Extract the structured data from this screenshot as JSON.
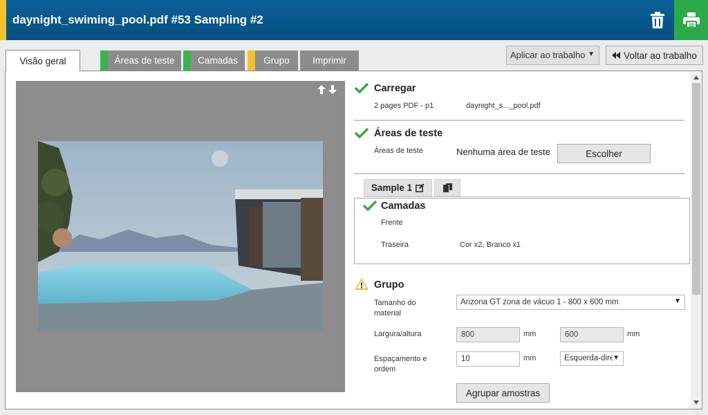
{
  "header": {
    "title": "daynight_swiming_pool.pdf #53 Sampling #2",
    "accent_color": "#f2c12e",
    "trash_icon": "trash-icon",
    "print_icon": "printer-icon"
  },
  "tabs": [
    {
      "label": "Visão geral",
      "active": true
    },
    {
      "label": "Áreas de teste",
      "status_color": "#3ab44a"
    },
    {
      "label": "Camadas",
      "status_color": "#3ab44a"
    },
    {
      "label": "Grupo",
      "status_color": "#f2c12e"
    },
    {
      "label": "Imprimir"
    }
  ],
  "toolbar": {
    "apply_label": "Aplicar ao trabalho",
    "back_label": "Voltar ao trabalho"
  },
  "load": {
    "title": "Carregar",
    "pages": "2 pages PDF - p1",
    "file": "daynight_s..._pool.pdf"
  },
  "test_areas": {
    "title": "Áreas de teste",
    "label": "Áreas de teste",
    "value": "Nenhuma área de teste",
    "choose_label": "Escolher"
  },
  "sample": {
    "tab_label": "Sample 1",
    "layers_title": "Camadas",
    "front_label": "Frente",
    "front_value": "",
    "back_label": "Traseira",
    "back_value": "Cor x2, Branco x1"
  },
  "group": {
    "title": "Grupo",
    "material_label": "Tamanho do material",
    "material_value": "Arizona GT zona de vácuo 1 - 800 x 600 mm",
    "size_label": "Largura/altura",
    "width": "800",
    "height": "600",
    "unit": "mm",
    "spacing_label": "Espaçamento e ordem",
    "spacing": "10",
    "order": "Esquerda-direita",
    "group_button": "Agrupar amostras"
  }
}
